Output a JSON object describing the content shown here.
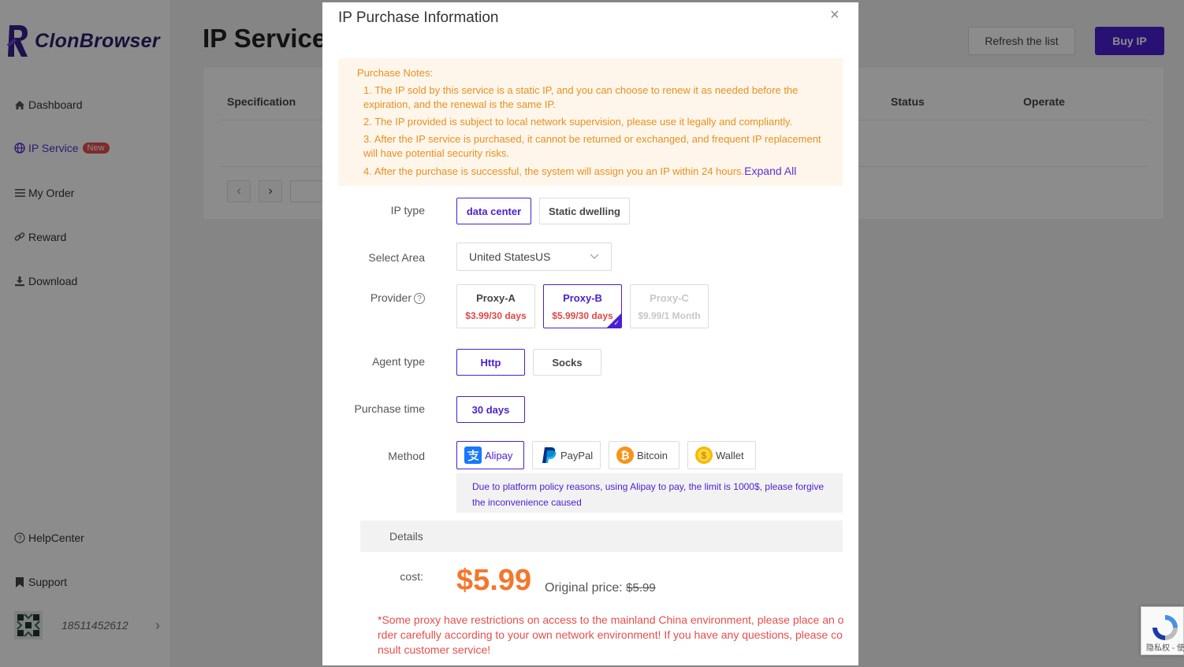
{
  "app": {
    "brand": "ClonBrowser",
    "nav": [
      {
        "label": "Dashboard",
        "icon": "home-icon"
      },
      {
        "label": "IP Service",
        "icon": "globe-icon",
        "badge": "New"
      },
      {
        "label": "My Order",
        "icon": "list-icon"
      },
      {
        "label": "Reward",
        "icon": "link-icon"
      },
      {
        "label": "Download",
        "icon": "download-icon"
      }
    ],
    "bottom_nav": [
      {
        "label": "HelpCenter",
        "icon": "help-circle-icon"
      },
      {
        "label": "Support",
        "icon": "bookmark-icon"
      }
    ],
    "user": {
      "phone": "18511452612"
    },
    "page_title": "IP Service",
    "buttons": {
      "refresh": "Refresh the list",
      "buy": "Buy IP"
    },
    "table_headers": {
      "specification": "Specification",
      "status": "Status",
      "operate": "Operate"
    }
  },
  "modal": {
    "title": "IP Purchase Information",
    "notes_title": "Purchase Notes:",
    "notes": [
      "1. The IP sold by this service is a static IP, and you can choose to renew it as needed before the expiration, and the renewal is the same IP.",
      "2. The IP provided is subject to local network supervision, please use it legally and compliantly.",
      "3. After the IP service is purchased, it cannot be returned or exchanged, and frequent IP replacement will have potential security risks.",
      "4. After the purchase is successful, the system will assign you an IP within 24 hours."
    ],
    "expand_all": "Expand All",
    "labels": {
      "ip_type": "IP type",
      "select_area": "Select Area",
      "provider": "Provider",
      "agent_type": "Agent type",
      "purchase_time": "Purchase time",
      "method": "Method",
      "details": "Details",
      "cost": "cost:"
    },
    "ip_types": [
      "data center",
      "Static dwelling"
    ],
    "selected_ip_type": "data center",
    "area": "United StatesUS",
    "providers": [
      {
        "name": "Proxy-A",
        "price": "$3.99/30 days",
        "state": "normal"
      },
      {
        "name": "Proxy-B",
        "price": "$5.99/30 days",
        "state": "selected"
      },
      {
        "name": "Proxy-C",
        "price": "$9.99/1 Month",
        "state": "disabled"
      }
    ],
    "agent_types": [
      "Http",
      "Socks"
    ],
    "selected_agent_type": "Http",
    "purchase_time": "30 days",
    "methods": [
      "Alipay",
      "PayPal",
      "Bitcoin",
      "Wallet"
    ],
    "selected_method": "Alipay",
    "alipay_note": "Due to platform policy reasons, using Alipay to pay, the limit is 1000$, please forgive the inconvenience caused",
    "cost": "$5.99",
    "original_price_label": "Original price:",
    "original_price": "$5.99",
    "warning": "*Some proxy have restrictions on access to the mainland China environment, please place an order carefully according to your own network environment! If you have any questions, please consult customer service!"
  },
  "recaptcha": {
    "text": "隐私权 - 使用条款"
  },
  "colors": {
    "accent": "#4a1fd1",
    "price": "#f5762a",
    "warning": "#e84d4d",
    "notes": "#e8901f"
  }
}
